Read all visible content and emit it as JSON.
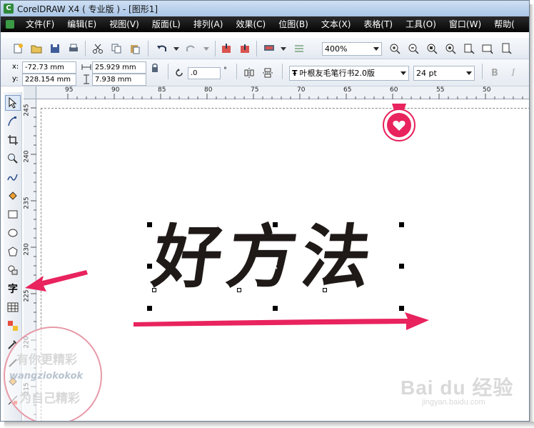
{
  "window": {
    "title": "CorelDRAW X4 ( 专业版 ) - [图形1]"
  },
  "menu": {
    "items": [
      "文件(F)",
      "编辑(E)",
      "视图(V)",
      "版面(L)",
      "排列(A)",
      "效果(C)",
      "位图(B)",
      "文本(X)",
      "表格(T)",
      "工具(O)",
      "窗口(W)",
      "帮助("
    ]
  },
  "toolbar": {
    "zoom": "400%"
  },
  "property_bar": {
    "x_label": "x:",
    "x_value": "-72.73 mm",
    "y_label": "y:",
    "y_value": "228.154 mm",
    "width_value": "25.929 mm",
    "height_value": "7.938 mm",
    "rotation_value": ".0",
    "rotation_unit": "°",
    "font_glyph": "Ŧ",
    "font_name": "叶根友毛笔行书2.0版",
    "font_size": "24 pt",
    "bold_label": "B",
    "italic_label": "I"
  },
  "ruler_top": {
    "labels": [
      "95",
      "90",
      "85",
      "80",
      "75",
      "70",
      "65",
      "60",
      "55",
      "50"
    ]
  },
  "ruler_left": {
    "labels": [
      "245",
      "240",
      "235",
      "230",
      "225",
      "220",
      "215"
    ]
  },
  "toolbox": {
    "text_tool_label": "字"
  },
  "canvas": {
    "artistic_text": "好方法"
  },
  "watermark": {
    "line1": "有你更精彩",
    "line2": "wangziokokok",
    "line3": "为自己精彩"
  },
  "baidu_watermark": {
    "logo": "Bai du 经验",
    "url": "jingyan.baidu.com"
  },
  "colors": {
    "annotation": "#e8235e",
    "menubar": "#0b0b0b",
    "titlebar": "#bcd2ee"
  }
}
